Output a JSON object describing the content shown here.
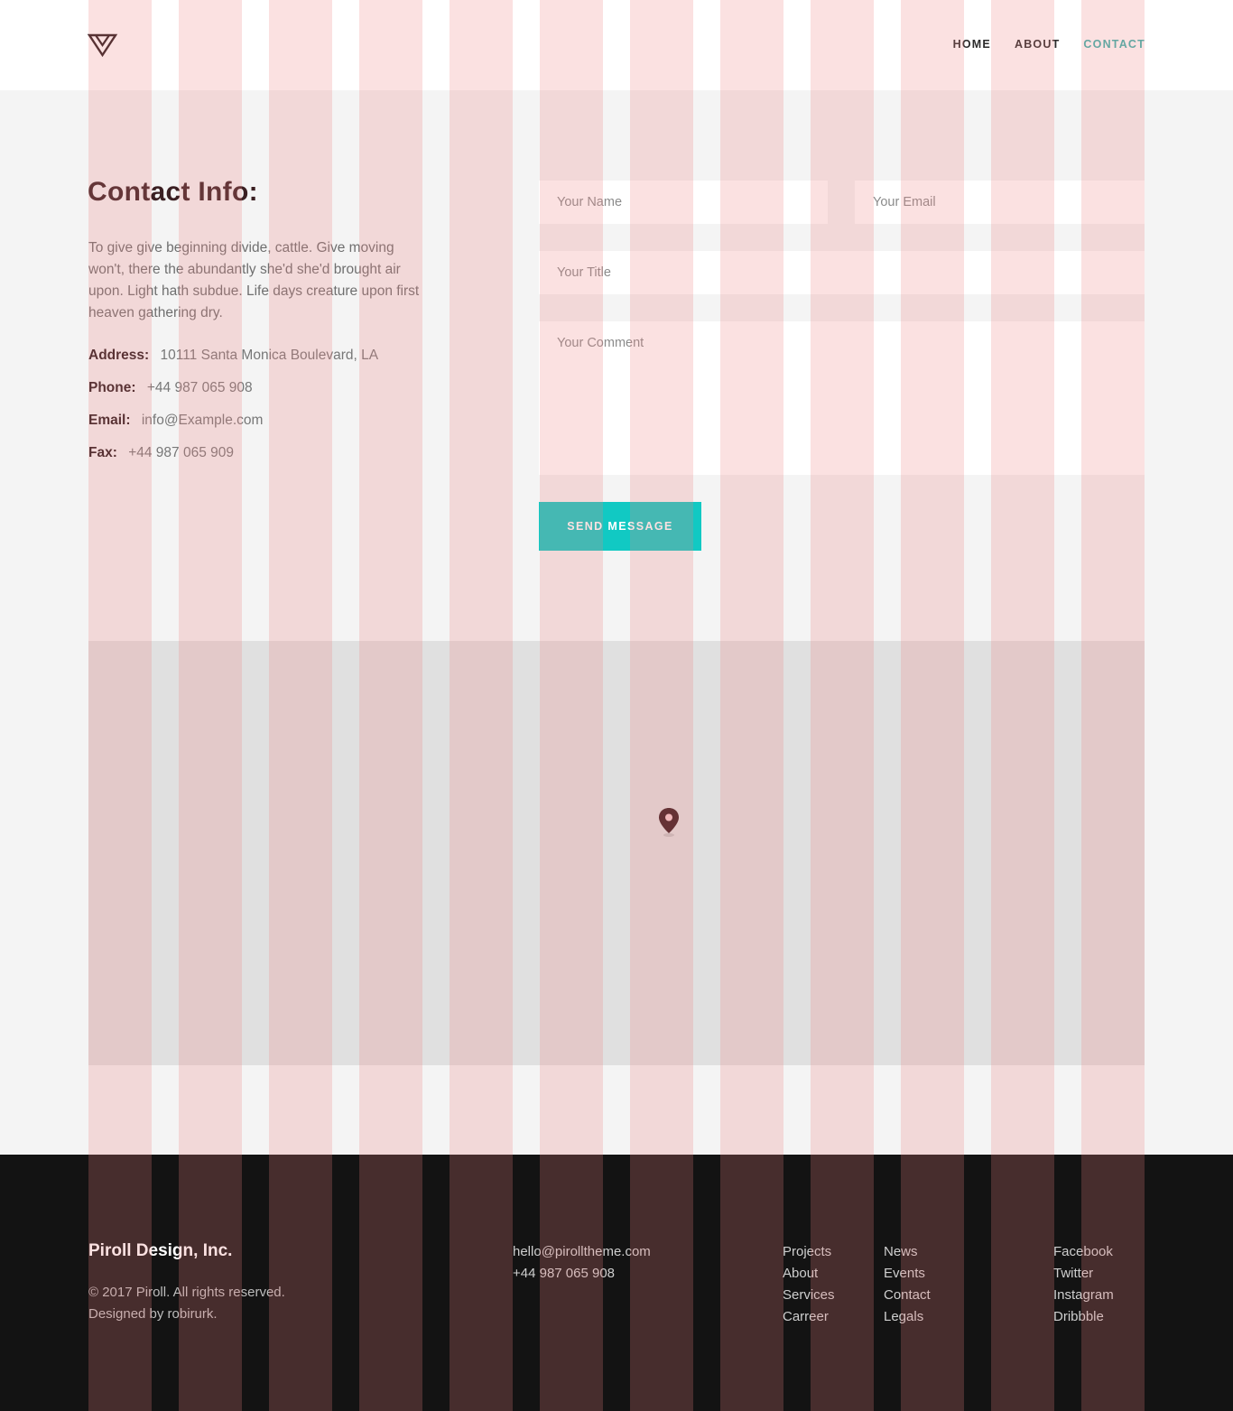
{
  "nav": {
    "items": [
      {
        "label": "HOME"
      },
      {
        "label": "ABOUT"
      },
      {
        "label": "CONTACT"
      }
    ]
  },
  "contact": {
    "title": "Contact Info:",
    "description": "To give give beginning divide, cattle. Give moving won't, there the abundantly she'd she'd brought air upon. Light hath subdue. Life days creature upon first heaven gathering dry.",
    "address_label": "Address:",
    "address": "10111 Santa Monica Boulevard, LA",
    "phone_label": "Phone:",
    "phone": "+44 987 065 908",
    "email_label": "Email:",
    "email": "info@Example.com",
    "fax_label": "Fax:",
    "fax": "+44 987 065 909"
  },
  "form": {
    "name_placeholder": "Your Name",
    "email_placeholder": "Your Email",
    "title_placeholder": "Your Title",
    "comment_placeholder": "Your Comment",
    "submit_label": "SEND MESSAGE"
  },
  "footer": {
    "company": "Piroll Design, Inc.",
    "copyright": "© 2017 Piroll. All rights reserved.",
    "designed_by": "Designed by robirurk.",
    "email": "hello@pirolltheme.com",
    "phone": "+44 987 065 908",
    "links_col1": [
      "Projects",
      "About",
      "Services",
      "Carreer"
    ],
    "links_col2": [
      "News",
      "Events",
      "Contact",
      "Legals"
    ],
    "social": [
      "Facebook",
      "Twitter",
      "Instagram",
      "Dribbble"
    ]
  },
  "colors": {
    "accent": "#11c9c3",
    "nav_active": "#3bb3ad",
    "heading": "#3a1f22",
    "footer_bg": "#131313",
    "grid_overlay": "rgba(240,128,128,0.24)"
  },
  "icons": {
    "logo": "triangle-logo-icon",
    "map_marker": "map-pin-icon"
  }
}
